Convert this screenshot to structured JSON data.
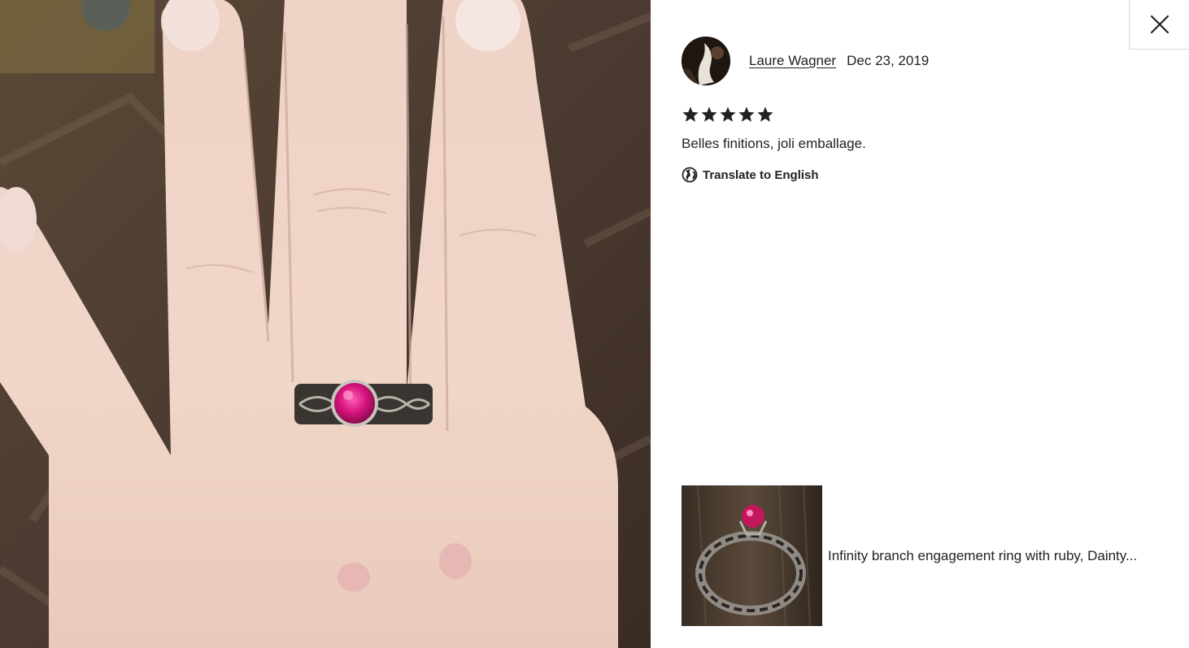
{
  "photo": {
    "icon": "review-photo-hand-with-ruby-ring"
  },
  "close": {
    "icon": "close-icon"
  },
  "review": {
    "reviewer_name": "Laure Wagner",
    "date": "Dec 23, 2019",
    "rating": 5,
    "rating_max": 5,
    "text": "Belles finitions, joli emballage.",
    "translate_label": "Translate to English",
    "translate_icon": "globe-icon"
  },
  "product": {
    "title": "Infinity branch engagement ring with ruby, Dainty...",
    "thumb_icon": "ring-product-thumbnail"
  },
  "colors": {
    "text": "#222222",
    "star": "#222222",
    "divider": "#d6d6d6"
  }
}
